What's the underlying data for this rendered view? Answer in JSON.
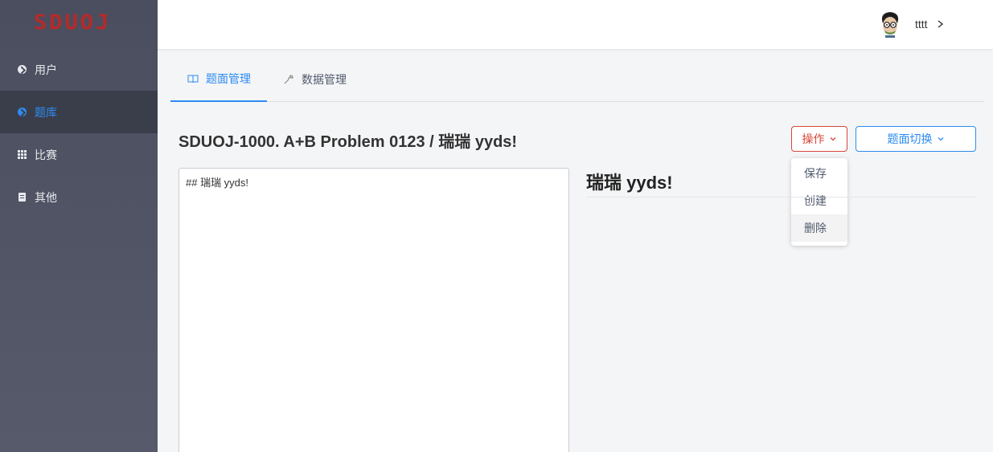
{
  "sidebar": {
    "logo": "SDUOJ",
    "items": [
      {
        "label": "用户",
        "icon": "circle-arrow-icon"
      },
      {
        "label": "题库",
        "icon": "circle-arrow-icon",
        "active": true
      },
      {
        "label": "比赛",
        "icon": "grid-icon"
      },
      {
        "label": "其他",
        "icon": "document-icon"
      }
    ]
  },
  "header": {
    "username": "tttt"
  },
  "tabs": [
    {
      "label": "题面管理",
      "icon": "book-icon",
      "active": true
    },
    {
      "label": "数据管理",
      "icon": "wrench-icon"
    }
  ],
  "problem": {
    "title": "SDUOJ-1000. A+B Problem 0123 / 瑞瑞 yyds!"
  },
  "actions": {
    "operate_label": "操作",
    "switch_label": "题面切换",
    "menu": [
      "保存",
      "创建",
      "删除"
    ]
  },
  "editor": {
    "content": "## 瑞瑞 yyds!"
  },
  "preview": {
    "heading": "瑞瑞 yyds!"
  },
  "colors": {
    "accent": "#2d8cf0",
    "danger": "#d9463a",
    "sidebar": "#4a4e5e"
  }
}
